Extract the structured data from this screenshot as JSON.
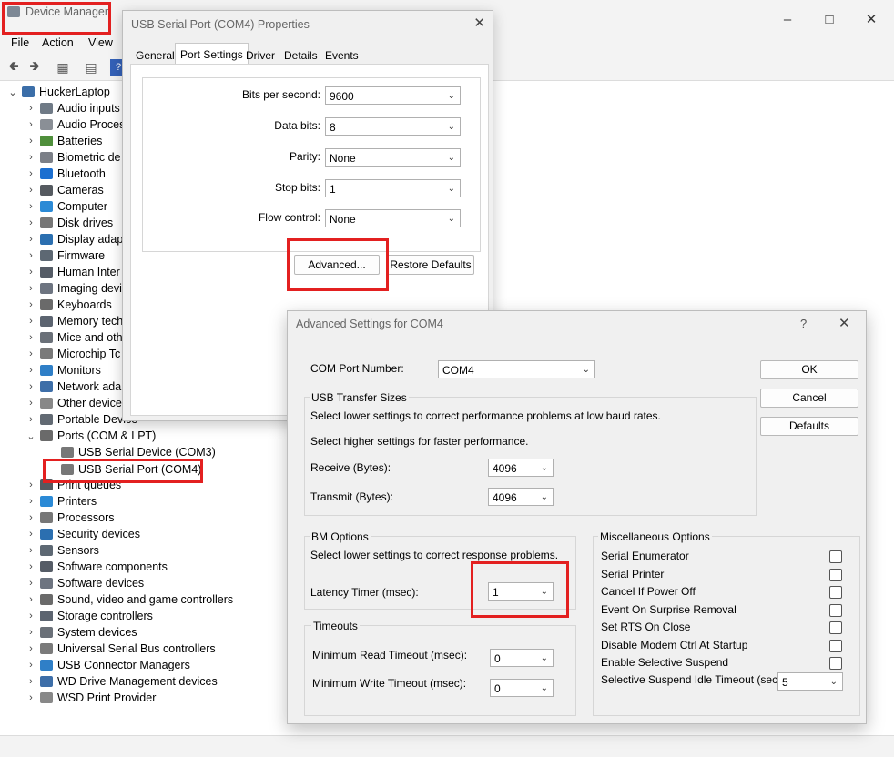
{
  "device_manager": {
    "title": "Device Manager",
    "menu": [
      "File",
      "Action",
      "View"
    ],
    "tree": {
      "root": "HuckerLaptop",
      "categories": [
        "Audio inputs",
        "Audio Proces",
        "Batteries",
        "Biometric de",
        "Bluetooth",
        "Cameras",
        "Computer",
        "Disk drives",
        "Display adap",
        "Firmware",
        "Human Inter",
        "Imaging devi",
        "Keyboards",
        "Memory tech",
        "Mice and oth",
        "Microchip Tc",
        "Monitors",
        "Network ada",
        "Other device",
        "Portable Device"
      ],
      "ports": {
        "label": "Ports (COM & LPT)",
        "children": [
          "USB Serial Device (COM3)",
          "USB Serial Port (COM4)"
        ]
      },
      "after": [
        "Print queues",
        "Printers",
        "Processors",
        "Security devices",
        "Sensors",
        "Software components",
        "Software devices",
        "Sound, video and game controllers",
        "Storage controllers",
        "System devices",
        "Universal Serial Bus controllers",
        "USB Connector Managers",
        "WD Drive Management devices",
        "WSD Print Provider"
      ]
    }
  },
  "properties": {
    "title": "USB Serial Port (COM4) Properties",
    "tabs": [
      "General",
      "Port Settings",
      "Driver",
      "Details",
      "Events"
    ],
    "active_tab": "Port Settings",
    "fields": [
      {
        "label": "Bits per second:",
        "value": "9600"
      },
      {
        "label": "Data bits:",
        "value": "8"
      },
      {
        "label": "Parity:",
        "value": "None"
      },
      {
        "label": "Stop bits:",
        "value": "1"
      },
      {
        "label": "Flow control:",
        "value": "None"
      }
    ],
    "advanced_button": "Advanced...",
    "restore_button": "Restore Defaults"
  },
  "advanced": {
    "title": "Advanced Settings for COM4",
    "help": "?",
    "com_port_label": "COM Port Number:",
    "com_port_value": "COM4",
    "ok": "OK",
    "cancel": "Cancel",
    "defaults": "Defaults",
    "transfer": {
      "title": "USB Transfer Sizes",
      "hint1": "Select lower settings to correct performance problems at low baud rates.",
      "hint2": "Select higher settings for faster performance.",
      "receive_label": "Receive (Bytes):",
      "receive_value": "4096",
      "transmit_label": "Transmit (Bytes):",
      "transmit_value": "4096"
    },
    "bm": {
      "title": "BM Options",
      "hint": "Select lower settings to correct response problems.",
      "latency_label": "Latency Timer (msec):",
      "latency_value": "1"
    },
    "timeouts": {
      "title": "Timeouts",
      "read_label": "Minimum Read Timeout (msec):",
      "read_value": "0",
      "write_label": "Minimum Write Timeout (msec):",
      "write_value": "0"
    },
    "misc": {
      "title": "Miscellaneous Options",
      "options": [
        "Serial Enumerator",
        "Serial Printer",
        "Cancel If Power Off",
        "Event On Surprise Removal",
        "Set RTS On Close",
        "Disable Modem Ctrl At Startup",
        "Enable Selective Suspend"
      ],
      "suspend_label": "Selective Suspend Idle Timeout (secs):",
      "suspend_value": "5"
    }
  }
}
